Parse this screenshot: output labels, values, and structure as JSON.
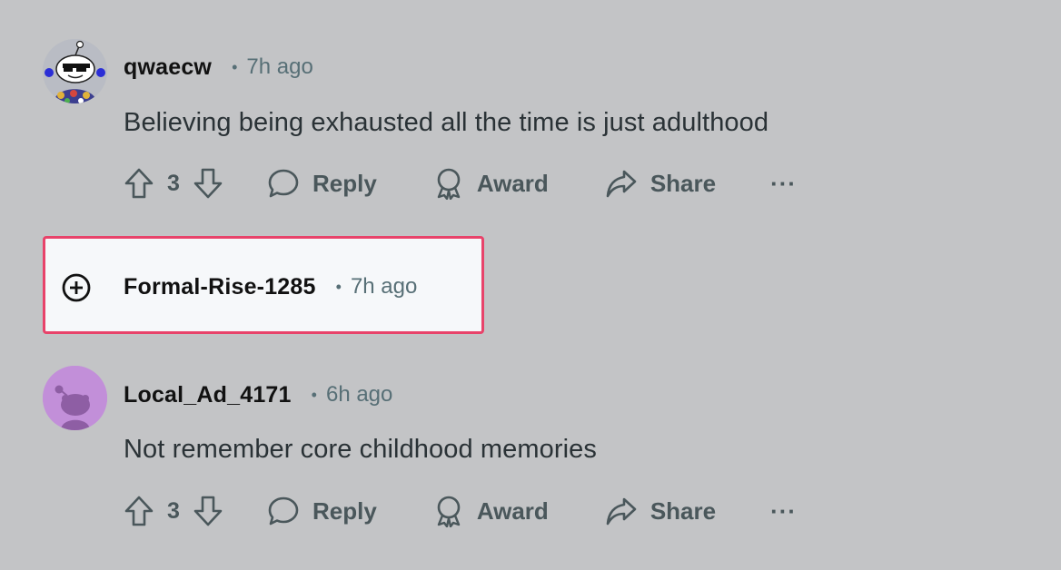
{
  "comments": [
    {
      "author": "qwaecw",
      "separator": "•",
      "time": "7h ago",
      "body": "Believing being exhausted all the time is just adulthood",
      "score": "3",
      "reply_label": "Reply",
      "award_label": "Award",
      "share_label": "Share",
      "more_label": "···"
    },
    {
      "author": "Formal-Rise-1285",
      "separator": "•",
      "time": "7h ago",
      "collapsed": true
    },
    {
      "author": "Local_Ad_4171",
      "separator": "•",
      "time": "6h ago",
      "body": "Not remember core childhood memories",
      "score": "3",
      "reply_label": "Reply",
      "award_label": "Award",
      "share_label": "Share",
      "more_label": "···"
    }
  ],
  "icons": {
    "upvote": "arrow-up-outline",
    "downvote": "arrow-down-outline",
    "reply": "speech-bubble",
    "award": "award-ribbon",
    "share": "share-arrow",
    "expand": "plus-circle"
  },
  "colors": {
    "background": "#c3c4c6",
    "highlight_border": "#e8436a",
    "highlight_fill": "#f6f8fa",
    "meta_text": "#576f76",
    "action_text": "#4a575b",
    "avatar_purple": "#c28fd9"
  }
}
